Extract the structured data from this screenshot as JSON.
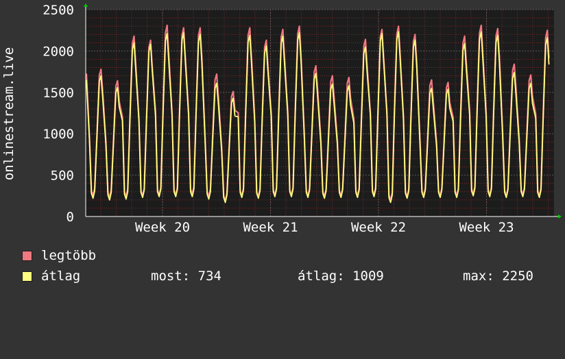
{
  "chart_data": {
    "type": "line",
    "ylabel": "onlinestream.live",
    "ylim": [
      0,
      2500
    ],
    "yticks": [
      0,
      500,
      1000,
      1500,
      2000,
      2500
    ],
    "x_tick_labels": [
      "Week 20",
      "Week 21",
      "Week 22",
      "Week 23"
    ],
    "grid": true,
    "colors": {
      "background": "#333333",
      "plot_bg": "#1c1c1c",
      "grid_major": "#5a5a5a",
      "grid_minor": "#7a2a2a",
      "legtobb": "#f07880",
      "atlag": "#ffff80",
      "arrow": "#00cc00"
    },
    "series": [
      {
        "name": "legtöbb",
        "color": "#f07880",
        "peaks": [
          1780,
          1640,
          2180,
          2130,
          2310,
          2280,
          2280,
          1720,
          1510,
          2280,
          2130,
          2260,
          2300,
          1820,
          1700,
          1680,
          2140,
          2260,
          2300,
          2200,
          1650,
          1620,
          2180,
          2310,
          2270,
          1840,
          1710,
          2250
        ],
        "troughs": [
          250,
          230,
          240,
          250,
          260,
          260,
          270,
          240,
          190,
          250,
          240,
          260,
          260,
          250,
          240,
          250,
          250,
          260,
          200,
          240,
          250,
          250,
          250,
          270,
          260,
          250,
          260,
          250
        ]
      },
      {
        "name": "átlag",
        "color": "#ffff80",
        "peaks": [
          1700,
          1560,
          2100,
          2080,
          2210,
          2220,
          2200,
          1610,
          1430,
          2190,
          2060,
          2180,
          2220,
          1730,
          1600,
          1580,
          2050,
          2210,
          2230,
          2130,
          1550,
          1540,
          2090,
          2230,
          2190,
          1740,
          1610,
          2160
        ],
        "troughs": [
          220,
          200,
          210,
          230,
          240,
          240,
          240,
          210,
          170,
          230,
          220,
          240,
          240,
          230,
          220,
          230,
          230,
          240,
          170,
          220,
          230,
          230,
          230,
          250,
          240,
          230,
          240,
          230
        ]
      }
    ]
  },
  "legend": [
    {
      "label": "legtöbb",
      "color": "#f07880"
    },
    {
      "label": "átlag",
      "color": "#ffff80"
    }
  ],
  "stats": {
    "most": "most: 734",
    "atlag": "átlag: 1009",
    "max": "max: 2250"
  }
}
